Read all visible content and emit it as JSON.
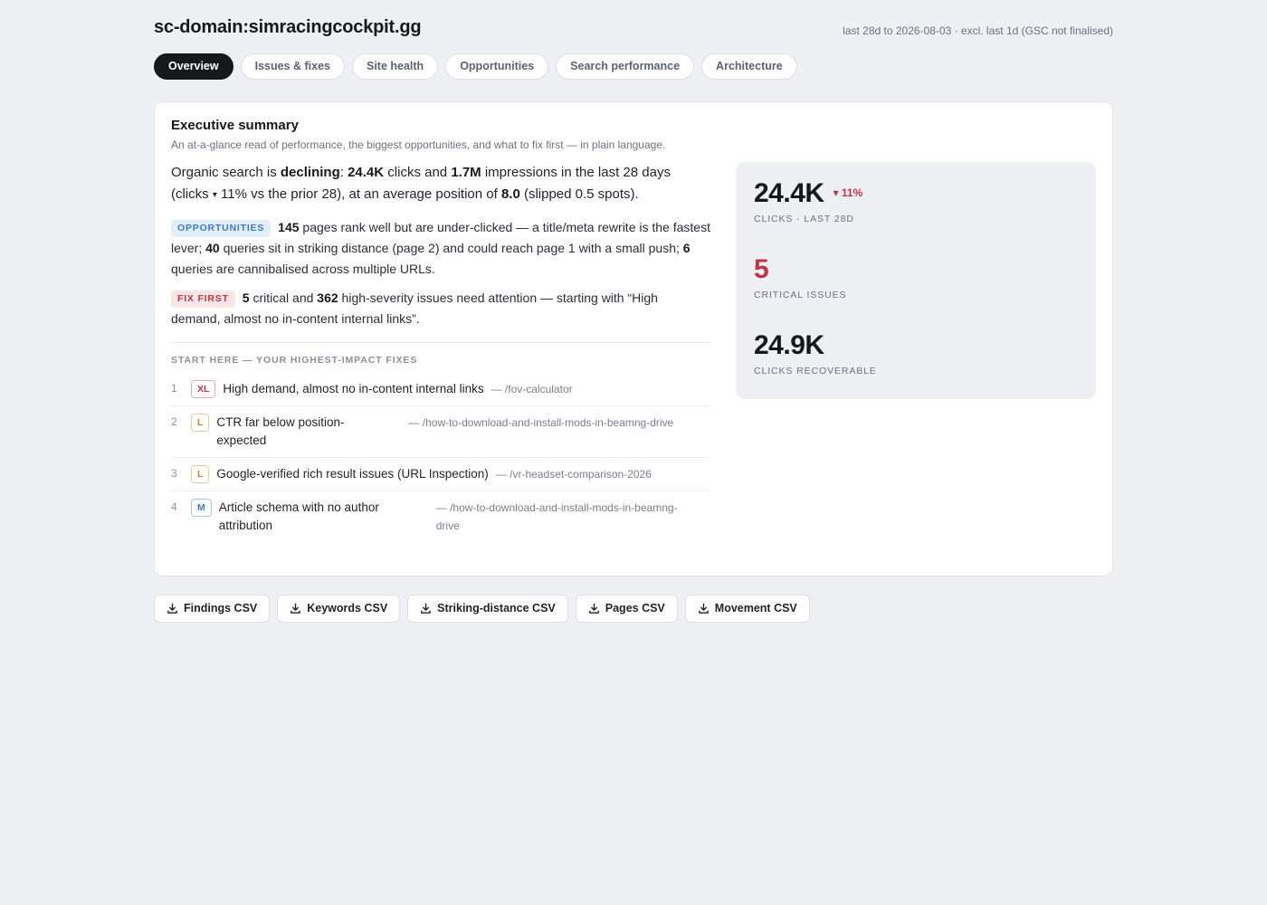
{
  "header": {
    "site": "sc-domain:simracingcockpit.gg",
    "daterange": "last 28d to 2026-08-03 · excl. last 1d (GSC not finalised)"
  },
  "tabs": [
    {
      "label": "Overview",
      "active": true
    },
    {
      "label": "Issues & fixes",
      "active": false
    },
    {
      "label": "Site health",
      "active": false
    },
    {
      "label": "Opportunities",
      "active": false
    },
    {
      "label": "Search performance",
      "active": false
    },
    {
      "label": "Architecture",
      "active": false
    }
  ],
  "summary": {
    "title": "Executive summary",
    "subtitle": "An at-a-glance read of performance, the biggest opportunities, and what to fix first — in plain language.",
    "lead": {
      "t1": "Organic search is ",
      "trend": "declining",
      "t2": ": ",
      "clicks": "24.4K",
      "t3": " clicks and ",
      "impressions": "1.7M",
      "t4": " impressions in the last 28 days (clicks ",
      "arrow": "▾",
      "t5": " 11% vs the prior 28), at an average position of ",
      "position": "8.0",
      "t6": " (slipped 0.5 spots)."
    },
    "opportunities": {
      "pill": "OPPORTUNITIES",
      "n1": "145",
      "t1": " pages rank well but are under-clicked — a title/meta rewrite is the fastest lever; ",
      "n2": "40",
      "t2": " queries sit in striking distance (page 2) and could reach page 1 with a small push; ",
      "n3": "6",
      "t3": " queries are cannibalised across multiple URLs."
    },
    "fix_first": {
      "pill": "FIX FIRST",
      "n1": "5",
      "t1": " critical and ",
      "n2": "362",
      "t2": " high-severity issues need attention — starting with “High demand, almost no in-content internal links”."
    },
    "start_here_label": "START HERE — YOUR HIGHEST-IMPACT FIXES",
    "fixes": [
      {
        "num": "1",
        "size": "XL",
        "title": "High demand, almost no in-content internal links",
        "url": "— /fov-calculator"
      },
      {
        "num": "2",
        "size": "L",
        "title": "CTR far below position-expected",
        "url": "— /how-to-download-and-install-mods-in-beamng-drive"
      },
      {
        "num": "3",
        "size": "L",
        "title": "Google-verified rich result issues (URL Inspection)",
        "url": "— /vr-headset-comparison-2026"
      },
      {
        "num": "4",
        "size": "M",
        "title": "Article schema with no author attribution",
        "url": "— /how-to-download-and-install-mods-in-beamng-drive"
      }
    ]
  },
  "stats": {
    "clicks": {
      "value": "24.4K",
      "delta": "▾ 11%",
      "label": "CLICKS · LAST 28D"
    },
    "critical": {
      "value": "5",
      "label": "CRITICAL ISSUES"
    },
    "recoverable": {
      "value": "24.9K",
      "label": "CLICKS RECOVERABLE"
    }
  },
  "downloads": [
    "Findings CSV",
    "Keywords CSV",
    "Striking-distance CSV",
    "Pages CSV",
    "Movement CSV"
  ],
  "colors": {
    "background": "#eff0f3",
    "accent_dark": "#16181c",
    "critical_red": "#c33345",
    "opportunity_blue": "#3a7bc8",
    "large_amber": "#b8862f"
  }
}
